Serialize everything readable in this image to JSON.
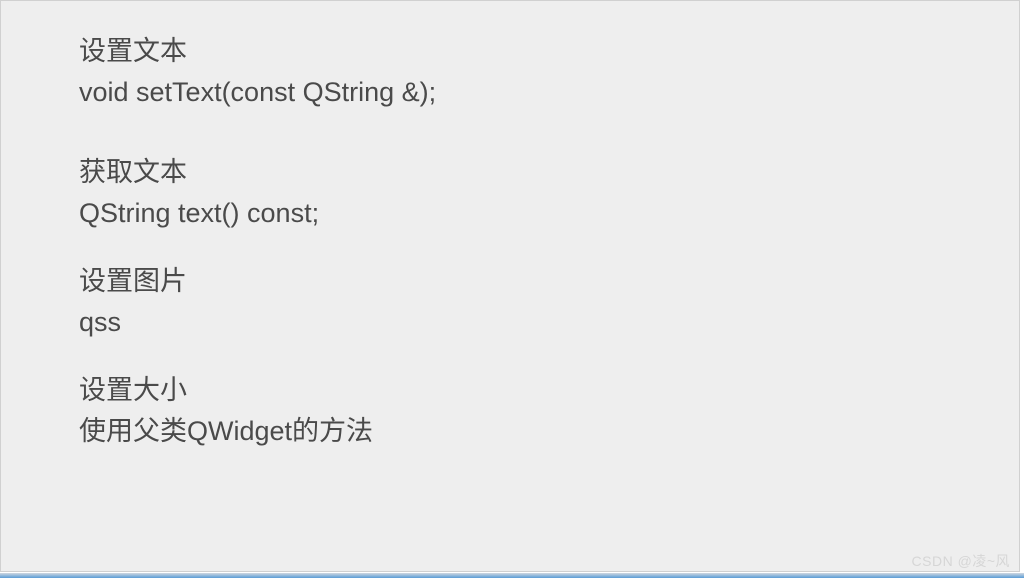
{
  "sections": [
    {
      "title": "设置文本",
      "body": "void setText(const QString &);"
    },
    {
      "title": "获取文本",
      "body": "QString text() const;"
    },
    {
      "title": "设置图片",
      "body": "qss"
    },
    {
      "title": "设置大小",
      "body": "使用父类QWidget的方法"
    }
  ],
  "watermark": "CSDN @凌~风"
}
